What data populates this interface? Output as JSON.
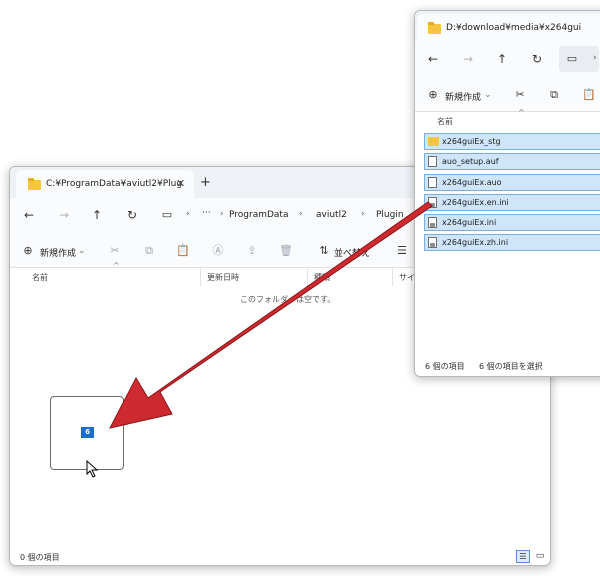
{
  "main_window": {
    "tab_title": "C:¥ProgramData¥aviutl2¥Plug",
    "new_tab_icon": "+",
    "breadcrumb": [
      "ProgramData",
      "aviutl2",
      "Plugin"
    ],
    "breadcrumb_more": "···",
    "new_label": "新規作成",
    "sort_label": "並べ替え",
    "columns": [
      "名前",
      "更新日時",
      "種類",
      "サイ"
    ],
    "empty_message": "このフォルダーは空です。",
    "status": "0 個の項目",
    "drag_count": "6"
  },
  "source_window": {
    "tab_title": "D:¥download¥media¥x264gui",
    "new_label": "新規作成",
    "column_name": "名前",
    "files": [
      {
        "name": "x264guiEx_stg",
        "icon": "folder-icon"
      },
      {
        "name": "auo_setup.auf",
        "icon": "document-icon"
      },
      {
        "name": "x264guiEx.auo",
        "icon": "document-icon"
      },
      {
        "name": "x264guiEx.en.ini",
        "icon": "settings-file-icon"
      },
      {
        "name": "x264guiEx.ini",
        "icon": "settings-file-icon"
      },
      {
        "name": "x264guiEx.zh.ini",
        "icon": "settings-file-icon"
      }
    ],
    "status_items": "6 個の項目",
    "status_selected": "6 個の項目を選択"
  },
  "colors": {
    "annotation_arrow": "#d42329",
    "selection": "#cfe6fa",
    "drag_badge": "#1a70c8"
  }
}
